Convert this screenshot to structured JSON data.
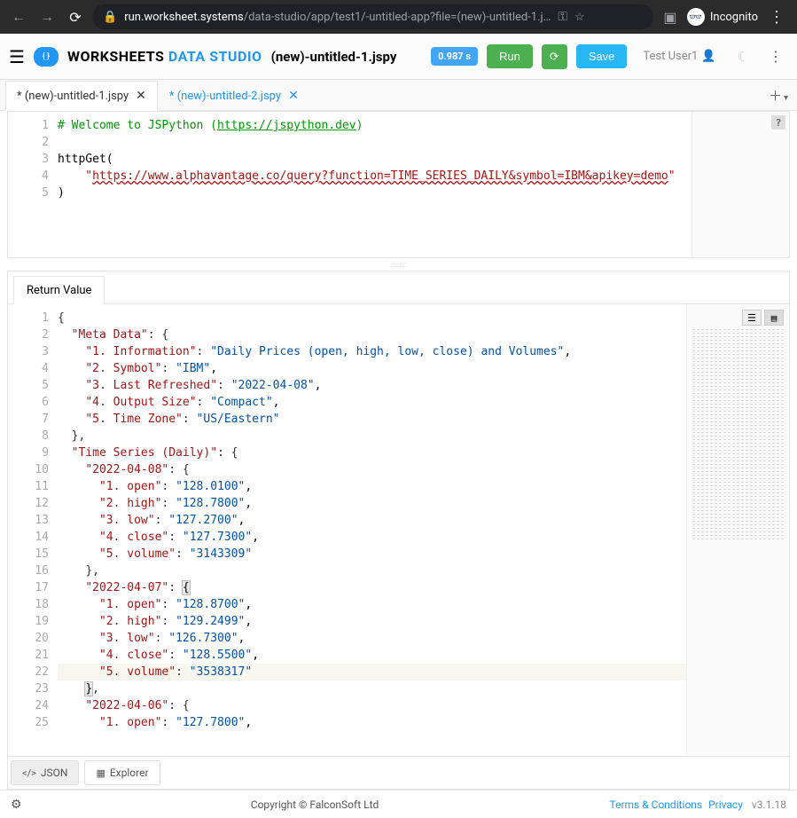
{
  "browser": {
    "host": "run.worksheet.systems",
    "path": "/data-studio/app/test1/-untitled-app?file=(new)-untitled-1.j…",
    "incognito_label": "Incognito"
  },
  "header": {
    "brand_a": "WORKSHEETS",
    "brand_b": "DATA STUDIO",
    "filename": "(new)-untitled-1.jspy",
    "timer": "0.987 s",
    "run_label": "Run",
    "run_icon_tip": "⟳",
    "save_label": "Save",
    "user": "Test User1"
  },
  "tabs": [
    {
      "label": "* (new)-untitled-1.jspy",
      "active": true
    },
    {
      "label": "* (new)-untitled-2.jspy",
      "active": false
    }
  ],
  "editor": {
    "lines": [
      "1",
      "2",
      "3",
      "4",
      "5"
    ],
    "code": {
      "l1_a": "# Welcome to JSPython (",
      "l1_b": "https://jspython.dev",
      "l1_c": ")",
      "l3": "httpGet(",
      "l4_a": "    \"",
      "l4_b": "https://www.alphavantage.co/query?function=TIME_SERIES_DAILY&symbol=IBM&apikey=demo",
      "l4_c": "\"",
      "l5": ")"
    }
  },
  "return": {
    "tab_label": "Return Value",
    "lines": [
      "1",
      "2",
      "3",
      "4",
      "5",
      "6",
      "7",
      "8",
      "9",
      "10",
      "11",
      "12",
      "13",
      "14",
      "15",
      "16",
      "17",
      "18",
      "19",
      "20",
      "21",
      "22",
      "23",
      "24",
      "25"
    ],
    "json": {
      "l1": "{",
      "l2": {
        "k": "Meta Data",
        "sep": ": {"
      },
      "l3": {
        "k": "1. Information",
        "v": "Daily Prices (open, high, low, close) and Volumes"
      },
      "l4": {
        "k": "2. Symbol",
        "v": "IBM"
      },
      "l5": {
        "k": "3. Last Refreshed",
        "v": "2022-04-08"
      },
      "l6": {
        "k": "4. Output Size",
        "v": "Compact"
      },
      "l7": {
        "k": "5. Time Zone",
        "v": "US/Eastern"
      },
      "l8": "},",
      "l9": {
        "k": "Time Series (Daily)",
        "sep": ": {"
      },
      "l10": {
        "k": "2022-04-08",
        "sep": ": {"
      },
      "l11": {
        "k": "1. open",
        "v": "128.0100"
      },
      "l12": {
        "k": "2. high",
        "v": "128.7800"
      },
      "l13": {
        "k": "3. low",
        "v": "127.2700"
      },
      "l14": {
        "k": "4. close",
        "v": "127.7300"
      },
      "l15": {
        "k": "5. volume",
        "v": "3143309"
      },
      "l16": "},",
      "l17": {
        "k": "2022-04-07",
        "sep": ": ",
        "br": "{"
      },
      "l18": {
        "k": "1. open",
        "v": "128.8700"
      },
      "l19": {
        "k": "2. high",
        "v": "129.2499"
      },
      "l20": {
        "k": "3. low",
        "v": "126.7300"
      },
      "l21": {
        "k": "4. close",
        "v": "128.5500"
      },
      "l22": {
        "k": "5. volume",
        "v": "3538317"
      },
      "l23": "},",
      "l24": {
        "k": "2022-04-06",
        "sep": ": {"
      },
      "l25": {
        "k": "1. open",
        "v": "127.7800"
      }
    },
    "bottom_tabs": {
      "json": "JSON",
      "explorer": "Explorer"
    }
  },
  "footer": {
    "copyright": "Copyright © FalconSoft Ltd",
    "terms": "Terms & Conditions",
    "privacy": "Privacy",
    "version": "v3.1.18"
  }
}
